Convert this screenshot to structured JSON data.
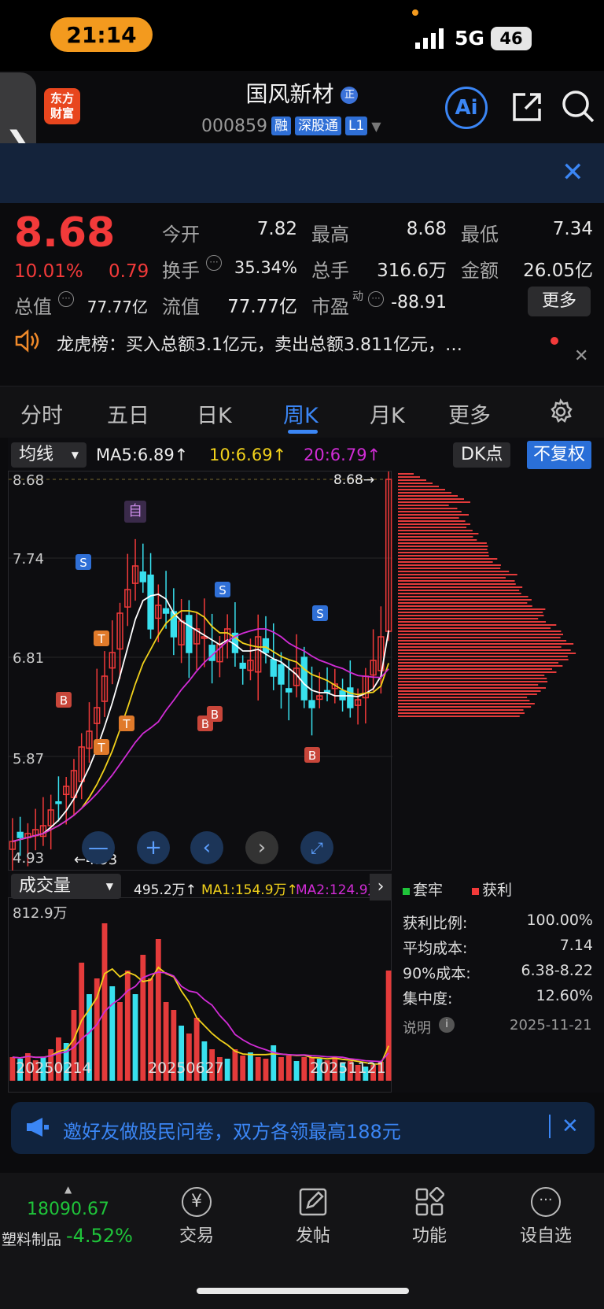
{
  "status": {
    "time": "21:14",
    "network": "5G",
    "battery": "46"
  },
  "header": {
    "logo_line1": "东方",
    "logo_line2": "财富",
    "name": "国风新材",
    "name_badge": "正",
    "code": "000859",
    "badges": [
      "融",
      "深股通",
      "L1"
    ],
    "ai_label": "Ai"
  },
  "quote": {
    "price": "8.68",
    "pct": "10.01%",
    "chg": "0.79",
    "fields": [
      {
        "label": "今开",
        "value": "7.82",
        "color": "grn"
      },
      {
        "label": "最高",
        "value": "8.68",
        "color": "red"
      },
      {
        "label": "最低",
        "value": "7.34",
        "color": "grn"
      },
      {
        "label": "换手",
        "value": "35.34%",
        "color": ""
      },
      {
        "label": "总手",
        "value": "316.6万",
        "color": ""
      },
      {
        "label": "金额",
        "value": "26.05亿",
        "color": ""
      },
      {
        "label": "总值",
        "value": "77.77亿",
        "color": ""
      },
      {
        "label": "流值",
        "value": "77.77亿",
        "color": ""
      },
      {
        "label": "市盈",
        "value": "-88.91",
        "color": ""
      }
    ],
    "pe_sup": "动",
    "more": "更多"
  },
  "news": {
    "text": "龙虎榜：买入总额3.1亿元，卖出总额3.811亿元，…"
  },
  "tabs": [
    "分时",
    "五日",
    "日K",
    "周K",
    "月K",
    "更多"
  ],
  "active_tab": "周K",
  "kchart": {
    "ma_select": "均线",
    "ma5": "MA5:6.89↑",
    "ma10": "10:6.69↑",
    "ma20": "20:6.79↑",
    "dk": "DK点",
    "fq": "不复权",
    "yticks": [
      "8.68",
      "7.74",
      "6.81",
      "5.87",
      "4.93"
    ],
    "max_label": "8.68→",
    "min_label": "←4.93",
    "marker_self": "自"
  },
  "vchart": {
    "select": "成交量",
    "vol": "495.2万↑",
    "ma1": "MA1:154.9万↑",
    "ma2": "MA2:124.9万",
    "ytick": "812.9万",
    "dates": [
      "20250214",
      "20250627",
      "20251121"
    ]
  },
  "chips": {
    "legend_trap": "套牢",
    "legend_profit": "获利",
    "rows": [
      {
        "k": "获利比例:",
        "v": "100.00%"
      },
      {
        "k": "平均成本:",
        "v": "7.14"
      },
      {
        "k": "90%成本:",
        "v": "6.38-8.22"
      },
      {
        "k": "集中度:",
        "v": "12.60%"
      }
    ],
    "note": "说明",
    "date": "2025-11-21"
  },
  "promo": {
    "text": "邀好友做股民问卷，双方各领最高188元"
  },
  "index": {
    "value": "18090.67",
    "name": "塑料制品",
    "pct": "-4.52%"
  },
  "nav": [
    {
      "label": "交易",
      "icon": "yen-icon"
    },
    {
      "label": "发帖",
      "icon": "edit-icon"
    },
    {
      "label": "功能",
      "icon": "grid-icon"
    },
    {
      "label": "设自选",
      "icon": "more-icon"
    }
  ]
}
